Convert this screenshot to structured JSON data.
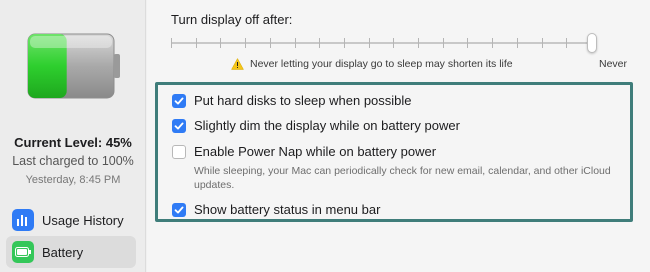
{
  "sidebar": {
    "current_level": "Current Level: 45%",
    "last_charged": "Last charged to 100%",
    "last_charged_time": "Yesterday, 8:45 PM",
    "battery_level_fraction": 0.45,
    "nav": [
      {
        "label": "Usage History",
        "icon": "bar-chart-icon"
      },
      {
        "label": "Battery",
        "icon": "battery-icon"
      }
    ]
  },
  "display": {
    "title": "Turn display off after:",
    "slider_value": "Never",
    "warning": "Never letting your display go to sleep may shorten its life"
  },
  "options": {
    "hard_disks": {
      "label": "Put hard disks to sleep when possible",
      "checked": true
    },
    "dim_display": {
      "label": "Slightly dim the display while on battery power",
      "checked": true
    },
    "power_nap": {
      "label": "Enable Power Nap while on battery power",
      "checked": false,
      "description": "While sleeping, your Mac can periodically check for new email, calendar, and other iCloud updates."
    },
    "battery_status": {
      "label": "Show battery status in menu bar",
      "checked": true
    }
  },
  "colors": {
    "accent": "#2f7bf5",
    "battery_green": "#34c759",
    "highlight_border": "#3f7d7a"
  }
}
